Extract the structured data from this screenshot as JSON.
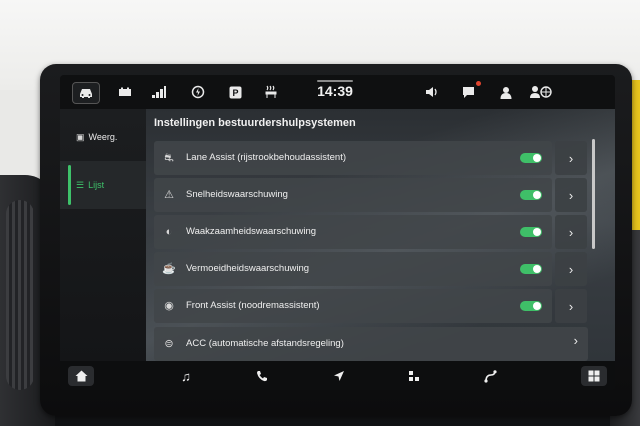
{
  "topbar": {
    "time": "14:39",
    "icons": [
      "car-icon",
      "battery-icon",
      "signal-bars-icon",
      "charging-icon",
      "parking-icon",
      "seat-heating-icon",
      "volume-icon",
      "notification-icon",
      "user-icon",
      "user-settings-icon"
    ]
  },
  "sidebar": {
    "items": [
      {
        "label": "Weerg.",
        "icon": "display-icon",
        "active": false
      },
      {
        "label": "Lijst",
        "icon": "list-icon",
        "active": true
      }
    ]
  },
  "content": {
    "title": "Instellingen bestuurdershulpsystemen",
    "rows": [
      {
        "label": "Lane Assist (rijstrookbehoudassistent)",
        "icon": "lane-assist-icon",
        "enabled": true
      },
      {
        "label": "Snelheidswaarschuwing",
        "icon": "speed-warning-icon",
        "enabled": true
      },
      {
        "label": "Waakzaamheidswaarschuwing",
        "icon": "attention-warning-icon",
        "enabled": true
      },
      {
        "label": "Vermoeidheidswaarschuwing",
        "icon": "fatigue-warning-icon",
        "enabled": true
      },
      {
        "label": "Front Assist (noodremassistent)",
        "icon": "front-assist-icon",
        "enabled": true
      },
      {
        "label": "ACC (automatische afstandsregeling)",
        "icon": "acc-icon",
        "enabled": false
      }
    ]
  },
  "bottombar": {
    "icons": [
      "home-icon",
      "music-icon",
      "phone-icon",
      "navigation-icon",
      "apps-icon",
      "connection-icon",
      "grid-icon"
    ]
  },
  "colors": {
    "accent": "#3ec26a",
    "screen_bg": "#17191b",
    "row_bg": "#41454a"
  }
}
